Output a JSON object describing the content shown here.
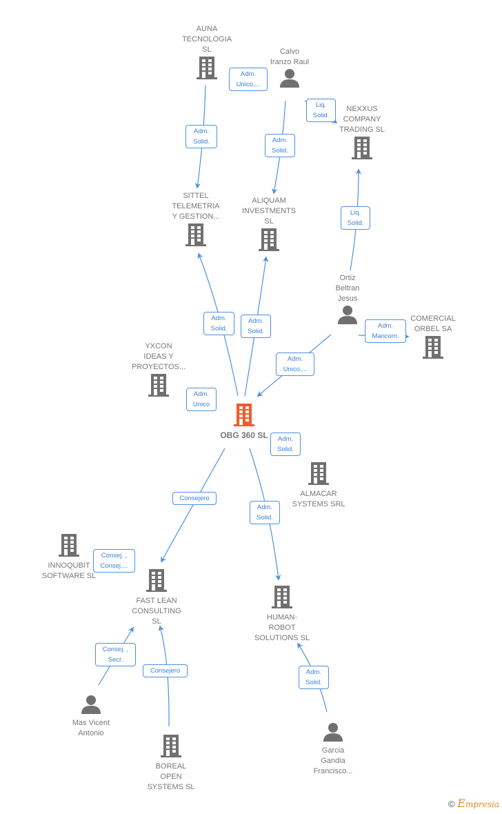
{
  "colors": {
    "edge": "#4a90e2",
    "label_text": "#3a7fd8",
    "node_icon": "#707070",
    "center_icon": "#f25a2b",
    "node_text": "#777777"
  },
  "nodes": [
    {
      "id": "auna",
      "type": "company",
      "name": "AUNA\nTECNOLOGIA\nSL"
    },
    {
      "id": "calvo",
      "type": "person",
      "name": "Calvo\nIranzo Raul"
    },
    {
      "id": "nexxus",
      "type": "company",
      "name": "NEXXUS\nCOMPANY\nTRADING  SL"
    },
    {
      "id": "sittel",
      "type": "company",
      "name": "SITTEL\nTELEMETRIA\nY GESTION..."
    },
    {
      "id": "aliquam",
      "type": "company",
      "name": "ALIQUAM\nINVESTMENTS\nSL"
    },
    {
      "id": "ortiz",
      "type": "person",
      "name": "Ortiz\nBeltran\nJesus"
    },
    {
      "id": "comercial",
      "type": "company",
      "name": "COMERCIAL\nORBEL SA"
    },
    {
      "id": "yxcon",
      "type": "company",
      "name": "YXCON\nIDEAS Y\nPROYECTOS..."
    },
    {
      "id": "obg",
      "type": "center",
      "name": "OBG 360  SL"
    },
    {
      "id": "almacar",
      "type": "company",
      "name": "ALMACAR\nSYSTEMS SRL"
    },
    {
      "id": "innoqubit",
      "type": "company",
      "name": "INNOQUBIT\nSOFTWARE  SL"
    },
    {
      "id": "fastlean",
      "type": "company",
      "name": "FAST LEAN\nCONSULTING\nSL"
    },
    {
      "id": "human",
      "type": "company",
      "name": "HUMAN-\nROBOT\nSOLUTIONS  SL"
    },
    {
      "id": "mas",
      "type": "person",
      "name": "Mas Vicent\nAntonio"
    },
    {
      "id": "boreal",
      "type": "company",
      "name": "BOREAL\nOPEN\nSYSTEMS  SL"
    },
    {
      "id": "garcia",
      "type": "person",
      "name": "Garcia\nGandia\nFrancisco..."
    }
  ],
  "edges": [
    {
      "from": "auna",
      "to": "sittel",
      "label": "Adm.\nSolid."
    },
    {
      "from": "calvo",
      "to": "auna",
      "label": "Adm.\nUnico,..."
    },
    {
      "from": "calvo",
      "to": "aliquam",
      "label": "Adm.\nSolid."
    },
    {
      "from": "calvo",
      "to": "nexxus",
      "label": "Liq.\nSolid."
    },
    {
      "from": "ortiz",
      "to": "nexxus",
      "label": "Liq.\nSolid."
    },
    {
      "from": "obg",
      "to": "sittel",
      "label": "Adm.\nSolid."
    },
    {
      "from": "obg",
      "to": "aliquam",
      "label": "Adm.\nSolid."
    },
    {
      "from": "ortiz",
      "to": "comercial",
      "label": "Adm.\nMancom."
    },
    {
      "from": "ortiz",
      "to": "obg",
      "label": "Adm.\nUnico,..."
    },
    {
      "from": "obg",
      "to": "yxcon",
      "label": "Adm.\nUnico"
    },
    {
      "from": "obg",
      "to": "almacar",
      "label": "Adm.\nSolid."
    },
    {
      "from": "obg",
      "to": "fastlean",
      "label": "Consejero"
    },
    {
      "from": "obg",
      "to": "human",
      "label": "Adm.\nSolid."
    },
    {
      "from": "fastlean",
      "to": "innoqubit",
      "label": "Consej. ,\nConsej...."
    },
    {
      "from": "mas",
      "to": "fastlean",
      "label": "Consej. ,\nSecr."
    },
    {
      "from": "boreal",
      "to": "fastlean",
      "label": "Consejero"
    },
    {
      "from": "garcia",
      "to": "human",
      "label": "Adm.\nSolid."
    }
  ],
  "footer": {
    "copyright": "©",
    "brand_initial": "E",
    "brand_rest": "mpresia"
  }
}
